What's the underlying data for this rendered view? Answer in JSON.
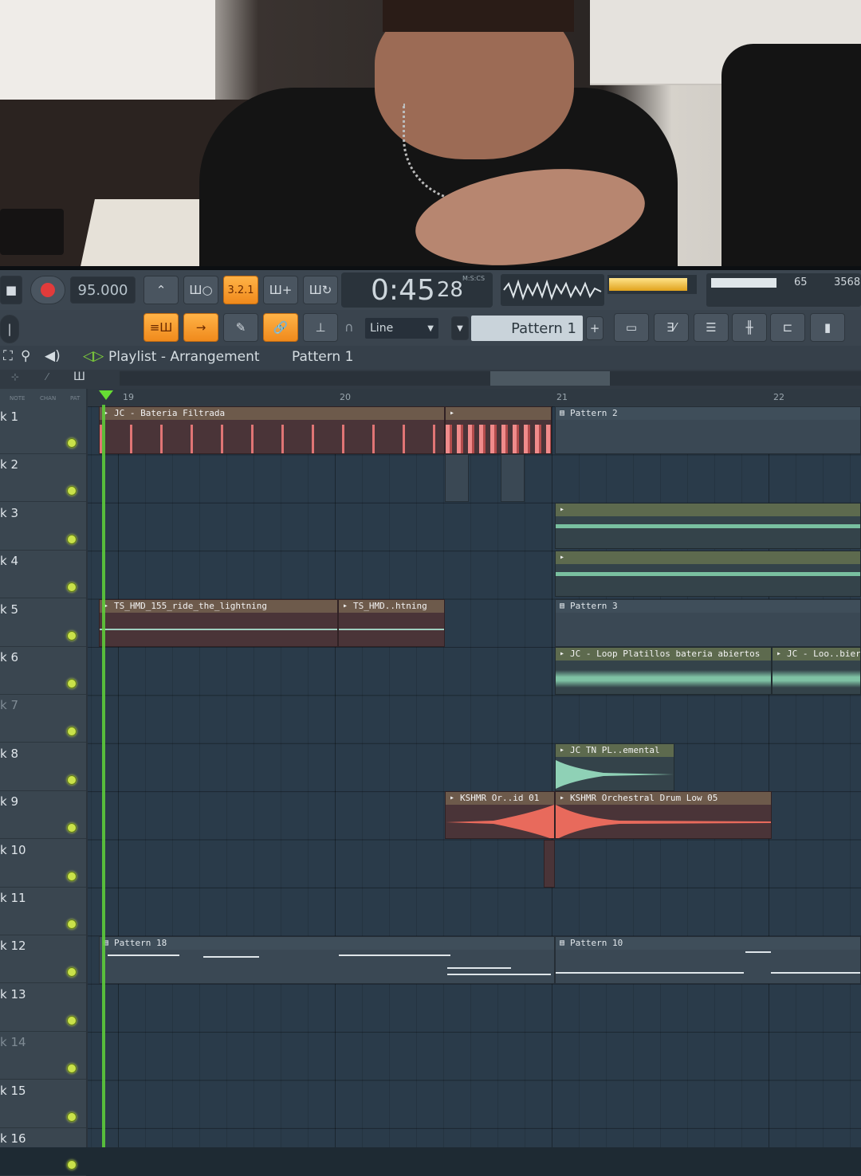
{
  "toolbar": {
    "tempo": "95.000",
    "snap_numbers": "3.2.1",
    "time_main": "0:45",
    "time_sub": "28",
    "time_units": "M:S:CS",
    "cpu": "65",
    "memory": "3568",
    "snap_mode": "Line",
    "pattern": "Pattern 1"
  },
  "playlist": {
    "title": "Playlist - Arrangement",
    "pattern": "Pattern 1",
    "header_labels": [
      "NOTE",
      "CHAN",
      "PAT"
    ],
    "ruler": [
      "19",
      "20",
      "21",
      "22"
    ]
  },
  "tracks": [
    {
      "label": "k 1"
    },
    {
      "label": "k 2"
    },
    {
      "label": "k 3"
    },
    {
      "label": "k 4"
    },
    {
      "label": "k 5"
    },
    {
      "label": "k 6"
    },
    {
      "label": "k 7"
    },
    {
      "label": "k 8"
    },
    {
      "label": "k 9"
    },
    {
      "label": "k 10"
    },
    {
      "label": "k 11"
    },
    {
      "label": "k 12"
    },
    {
      "label": "k 13"
    },
    {
      "label": "k 14"
    },
    {
      "label": "k 15"
    },
    {
      "label": "k 16"
    }
  ],
  "clips": {
    "bateria": "JC - Bateria Filtrada",
    "pattern2": "Pattern 2",
    "ride1": "TS_HMD_155_ride_the_lightning",
    "ride2": "TS_HMD..htning",
    "pattern3": "Pattern 3",
    "platillos1": "JC - Loop Platillos bateria abiertos",
    "platillos2": "JC - Loo..bier",
    "tn": "JC TN PL..emental",
    "kshmr1": "KSHMR Or..id 01",
    "kshmr2": "KSHMR Orchestral Drum Low 05",
    "pattern18": "Pattern 18",
    "pattern10": "Pattern 10"
  }
}
